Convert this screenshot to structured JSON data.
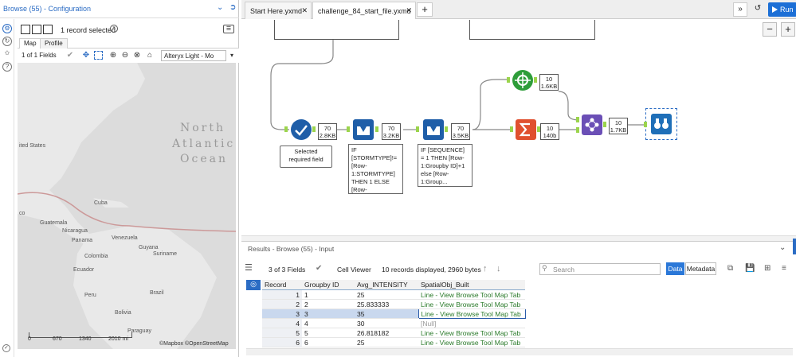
{
  "config_panel": {
    "title": "Browse (55) - Configuration",
    "records_selected": "1 record selected",
    "tabs": [
      "Map",
      "Profile"
    ],
    "fields_dropdown": "1 of 1 Fields",
    "basemap": "Alteryx Light - Mo",
    "map_labels": {
      "ocean_1": "North",
      "ocean_2": "Atlantic",
      "ocean_3": "Ocean",
      "us": "ited States",
      "cuba": "Cuba",
      "guatemala": "Guatemala",
      "nicaragua": "Nicaragua",
      "panama": "Panama",
      "venezuela": "Venezuela",
      "guyana": "Guyana",
      "suriname": "Suriname",
      "colombia": "Colombia",
      "ecuador": "Ecuador",
      "peru": "Peru",
      "brazil": "Brazil",
      "bolivia": "Bolivia",
      "paraguay": "Paraguay",
      "mexico": "co"
    },
    "scale": {
      "s0": "0",
      "s1": "670",
      "s2": "1340",
      "s3": "2010 mi"
    },
    "attribution": "©Mapbox ©OpenStreetMap"
  },
  "doc_tabs": [
    {
      "label": "Start Here.yxmd"
    },
    {
      "label": "challenge_84_start_file.yxmd"
    }
  ],
  "run_label": "Run",
  "canvas": {
    "tools": {
      "select": {
        "badge_records": "70",
        "badge_size": "2.8KB",
        "annotation": "Selected required field"
      },
      "formula1": {
        "badge_records": "70",
        "badge_size": "3.2KB",
        "annotation": "IF [STORMTYPE]!=[Row-1:STORMTYPE] THEN 1 ELSE [Row-1:SEQUENCE..."
      },
      "formula2": {
        "badge_records": "70",
        "badge_size": "3.5KB",
        "annotation": "IF [SEQUENCE] = 1 THEN [Row-1:Groupby ID]+1 else [Row-1:Group..."
      },
      "summarize": {
        "badge_records": "10",
        "badge_size": "140b"
      },
      "spatial": {
        "badge_records": "10",
        "badge_size": "1.6KB"
      },
      "poly_build": {
        "badge_records": "10",
        "badge_size": "1.7KB"
      }
    },
    "colors": {
      "anchor": "#9bd44c",
      "select": "#1f5ea8",
      "formula": "#1f5ea8",
      "summarize": "#e0502e",
      "spatial": "#2e9d3a",
      "join": "#6b4fb6",
      "browse": "#1f6fb8"
    }
  },
  "results": {
    "title": "Results - Browse (55) - Input",
    "fields": "3 of 3 Fields",
    "viewer": "Cell Viewer",
    "summary": "10 records displayed, 2960 bytes",
    "search_placeholder": "Search",
    "data_btn": "Data",
    "metadata_btn": "Metadata",
    "columns": [
      "Record",
      "Groupby ID",
      "Avg_INTENSITY",
      "SpatialObj_Built"
    ],
    "rows": [
      [
        "1",
        "1",
        "25",
        "Line - View Browse Tool Map Tab"
      ],
      [
        "2",
        "2",
        "25.833333",
        "Line - View Browse Tool Map Tab"
      ],
      [
        "3",
        "3",
        "35",
        "Line - View Browse Tool Map Tab"
      ],
      [
        "4",
        "4",
        "30",
        "[Null]"
      ],
      [
        "5",
        "5",
        "26.818182",
        "Line - View Browse Tool Map Tab"
      ],
      [
        "6",
        "6",
        "25",
        "Line - View Browse Tool Map Tab"
      ]
    ],
    "selected_row": 2
  }
}
